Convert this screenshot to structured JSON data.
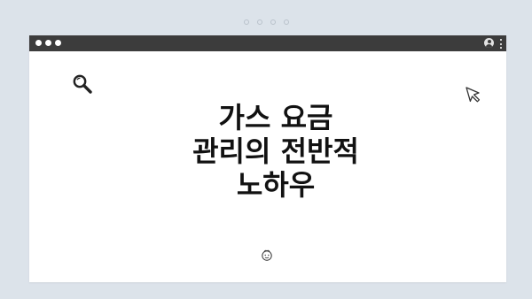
{
  "window": {
    "headline": "가스 요금\n관리의 전반적\n노하우"
  },
  "icons": {
    "search": "search-icon",
    "cursor": "cursor-arrow-icon",
    "face": "smiley-face-icon",
    "profile": "profile-icon",
    "menu": "kebab-menu-icon"
  },
  "colors": {
    "background": "#dce3ea",
    "titlebar": "#3c3c3c",
    "window": "#ffffff",
    "text": "#111111"
  }
}
